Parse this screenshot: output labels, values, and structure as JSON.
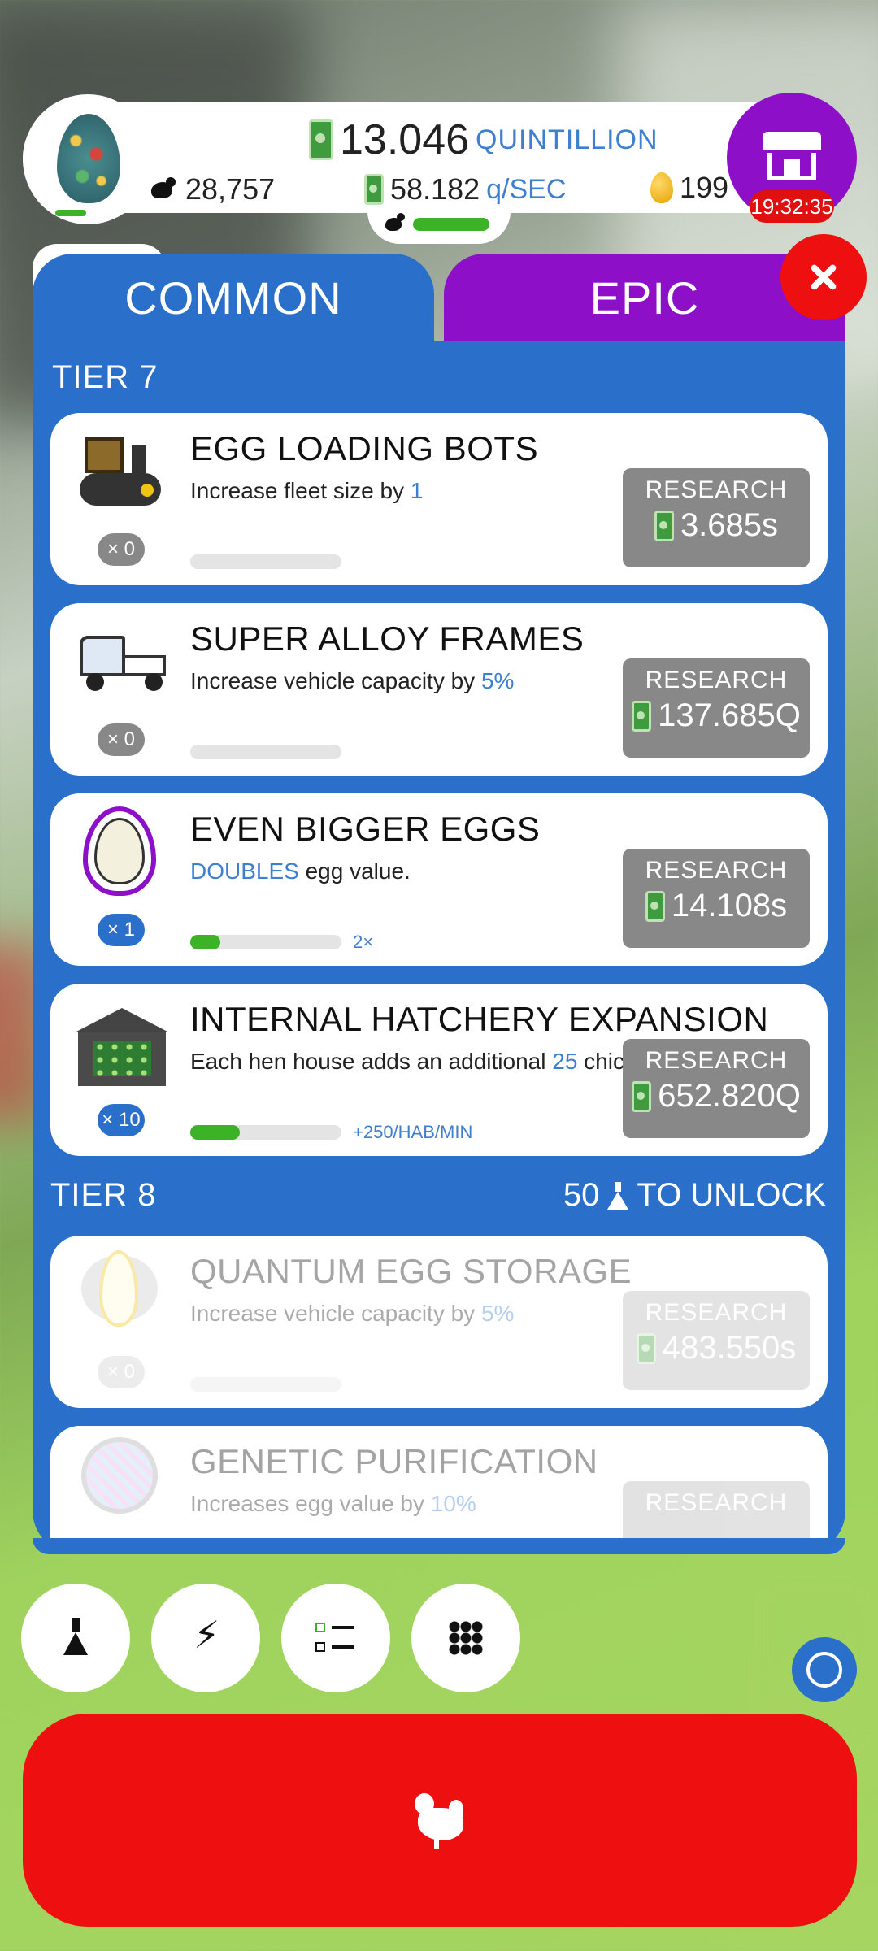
{
  "header": {
    "money_value": "13.046",
    "money_unit": "QUINTILLION",
    "rate_value": "58.182",
    "rate_unit": "q/SEC",
    "chickens": "28,757",
    "golden_eggs": "199",
    "shop_timer": "19:32:35"
  },
  "tabs": {
    "common": "COMMON",
    "epic": "EPIC"
  },
  "tiers": {
    "tier7": "TIER 7",
    "tier8": "TIER 8",
    "tier8_unlock_count": "50",
    "tier8_unlock_text": "TO UNLOCK"
  },
  "research": [
    {
      "title": "EGG LOADING BOTS",
      "desc_pre": "Increase fleet size by ",
      "desc_hl": "1",
      "desc_post": "",
      "count": "× 0",
      "button_label": "RESEARCH",
      "price": "3.685s",
      "progress": 0,
      "progress_note": ""
    },
    {
      "title": "SUPER ALLOY FRAMES",
      "desc_pre": "Increase vehicle capacity by ",
      "desc_hl": "5%",
      "desc_post": "",
      "count": "× 0",
      "button_label": "RESEARCH",
      "price": "137.685Q",
      "progress": 0,
      "progress_note": ""
    },
    {
      "title": "EVEN BIGGER EGGS",
      "desc_pre": "",
      "desc_hl": "DOUBLES",
      "desc_post": " egg value.",
      "count": "× 1",
      "button_label": "RESEARCH",
      "price": "14.108s",
      "progress": 0.2,
      "progress_note": "2×"
    },
    {
      "title": "INTERNAL HATCHERY EXPANSION",
      "desc_pre": "Each hen house adds an additional ",
      "desc_hl": "25",
      "desc_post": " chickens/min",
      "count": "× 10",
      "button_label": "RESEARCH",
      "price": "652.820Q",
      "progress": 0.33,
      "progress_note": "+250/HAB/MIN"
    },
    {
      "title": "QUANTUM EGG STORAGE",
      "desc_pre": "Increase vehicle capacity by ",
      "desc_hl": "5%",
      "desc_post": "",
      "count": "× 0",
      "button_label": "RESEARCH",
      "price": "483.550s",
      "progress": 0,
      "progress_note": ""
    },
    {
      "title": "GENETIC PURIFICATION",
      "desc_pre": "Increases egg value by ",
      "desc_hl": "10%",
      "desc_post": "",
      "count": "",
      "button_label": "RESEARCH",
      "price": "",
      "progress": 0,
      "progress_note": ""
    }
  ],
  "icons": {
    "card0": "loading-bot-icon",
    "card1": "truck-icon",
    "card2": "egg-icon",
    "card3": "hen-house-icon",
    "card4": "quantum-egg-icon",
    "card5": "dna-icon"
  },
  "colors": {
    "panel_blue": "#2a6fc9",
    "epic_purple": "#8d0fc8",
    "alert_red": "#ee1010",
    "progress_green": "#3cb327",
    "highlight_blue": "#3f7fd0"
  }
}
